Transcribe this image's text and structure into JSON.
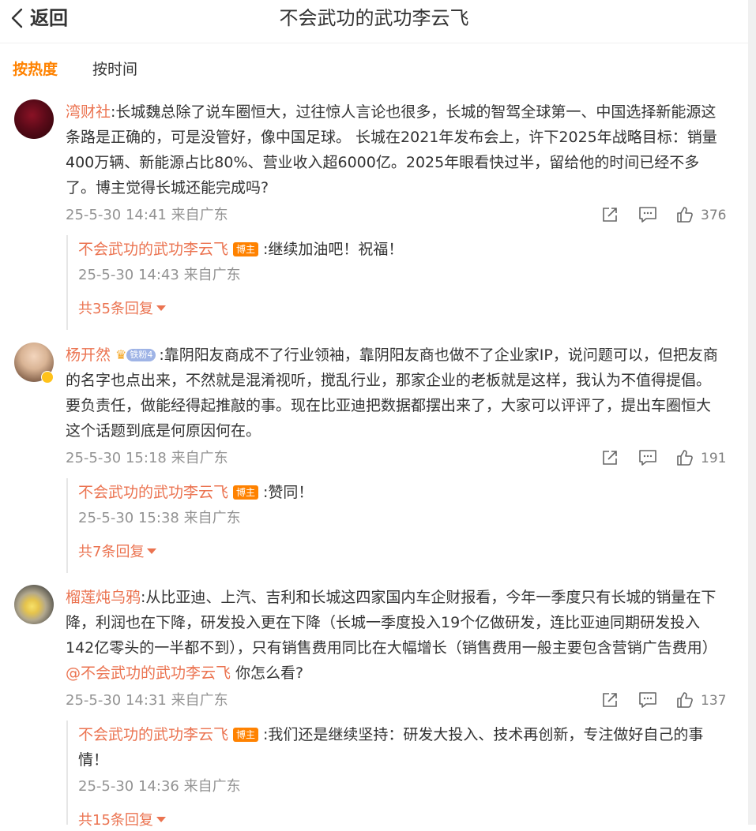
{
  "header": {
    "back_label": "返回",
    "title": "不会武功的武功李云飞"
  },
  "tabs": [
    {
      "label": "按热度",
      "active": true
    },
    {
      "label": "按时间",
      "active": false
    }
  ],
  "bozhu_label": "博主",
  "comments": [
    {
      "username": "湾财社",
      "text": ":长城魏总除了说车圈恒大，过往惊人言论也很多，长城的智驾全球第一、中国选择新能源这条路是正确的，可是没管好，像中国足球。 长城在2021年发布会上，许下2025年战略目标：销量400万辆、新能源占比80%、营业收入超6000亿。2025年眼看快过半，留给他的时间已经不多了。博主觉得长城还能完成吗?",
      "meta": "25-5-30 14:41 来自广东",
      "likes": "376",
      "reply": {
        "username": "不会武功的武功李云飞",
        "text": ":继续加油吧！祝福！",
        "meta": "25-5-30 14:43 来自广东"
      },
      "more": "共35条回复"
    },
    {
      "username": "杨开然",
      "fan_badge": "铁粉4",
      "text": ":靠阴阳友商成不了行业领袖，靠阴阳友商也做不了企业家IP，说问题可以，但把友商的名字也点出来，不然就是混淆视听，搅乱行业，那家企业的老板就是这样，我认为不值得提倡。要负责任，做能经得起推敲的事。现在比亚迪把数据都摆出来了，大家可以评评了，提出车圈恒大这个话题到底是何原因何在。",
      "meta": "25-5-30 15:18 来自广东",
      "likes": "191",
      "reply": {
        "username": "不会武功的武功李云飞",
        "text": ":赞同！",
        "meta": "25-5-30 15:38 来自广东"
      },
      "more": "共7条回复"
    },
    {
      "username": "榴莲炖乌鸦",
      "text": ":从比亚迪、上汽、吉利和长城这四家国内车企财报看，今年一季度只有长城的销量在下降，利润也在下降，研发投入更在下降（长城一季度投入19个亿做研发，连比亚迪同期研发投入142亿零头的一半都不到），只有销售费用同比在大幅增长（销售费用一般主要包含营销广告费用）",
      "mention": "@不会武功的武功李云飞",
      "text_after": " 你怎么看?",
      "meta": "25-5-30 14:31 来自广东",
      "likes": "137",
      "reply": {
        "username": "不会武功的武功李云飞",
        "text": ":我们还是继续坚持：研发大投入、技术再创新，专注做好自己的事情！",
        "meta": "25-5-30 14:36 来自广东"
      },
      "more": "共15条回复"
    }
  ]
}
